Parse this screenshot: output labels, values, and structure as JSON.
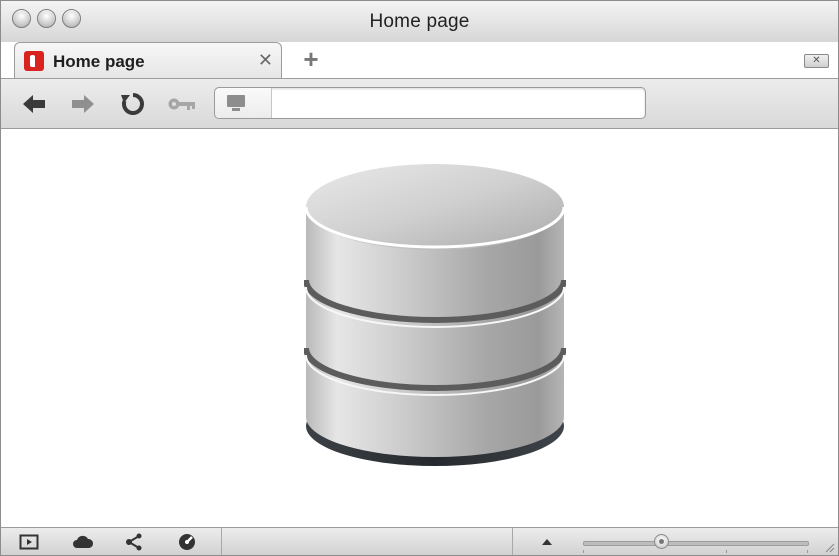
{
  "window": {
    "title": "Home page"
  },
  "tabs": [
    {
      "label": "Home page",
      "close_glyph": "✕",
      "active": true,
      "favicon": "app-logo-icon"
    }
  ],
  "tabbar": {
    "new_tab_glyph": "+",
    "tab_overview_glyph": "✕"
  },
  "toolbar": {
    "buttons": [
      "back-icon",
      "forward-icon",
      "reload-icon",
      "key-icon"
    ],
    "address": {
      "value": "",
      "placeholder": "",
      "icon": "monitor-icon"
    }
  },
  "content": {
    "image": "database-icon"
  },
  "statusbar": {
    "icons": [
      "panel-toggle-icon",
      "cloud-icon",
      "share-icon",
      "speed-dial-icon",
      "triangle-up-icon"
    ],
    "zoom_level": 0.35
  },
  "colors": {
    "favicon": "#d8231f",
    "db_dark": "#2e3338"
  }
}
